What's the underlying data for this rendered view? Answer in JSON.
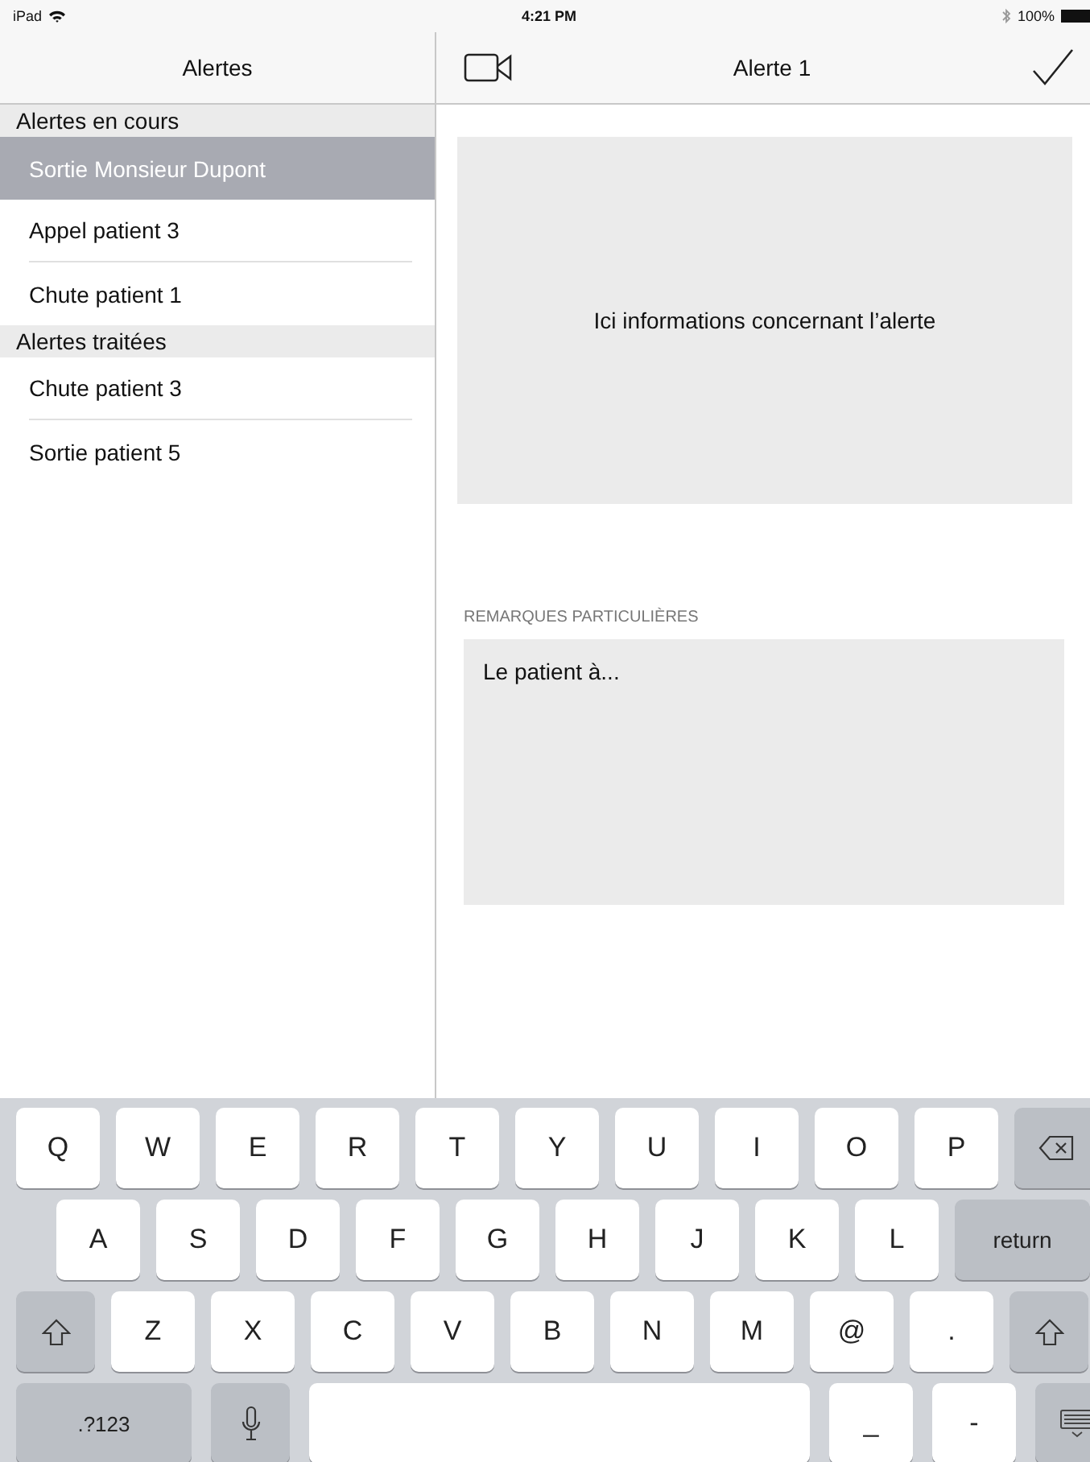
{
  "status_bar": {
    "carrier": "iPad",
    "time": "4:21 PM",
    "battery": "100%"
  },
  "master": {
    "title": "Alertes",
    "sections": [
      {
        "title": "Alertes en cours",
        "items": [
          {
            "label": "Sortie Monsieur Dupont",
            "selected": true
          },
          {
            "label": "Appel patient 3",
            "selected": false
          },
          {
            "label": "Chute patient 1",
            "selected": false
          }
        ]
      },
      {
        "title": "Alertes traitées",
        "items": [
          {
            "label": "Chute patient 3",
            "selected": false
          },
          {
            "label": "Sortie patient 5",
            "selected": false
          }
        ]
      }
    ]
  },
  "detail": {
    "title": "Alerte 1",
    "info": "Ici informations concernant l’alerte",
    "remarks_label": "REMARQUES PARTICULIÈRES",
    "remarks_value": "Le patient à..."
  },
  "keyboard": {
    "rows": [
      [
        {
          "kind": "char",
          "label": "Q"
        },
        {
          "kind": "char",
          "label": "W"
        },
        {
          "kind": "char",
          "label": "E"
        },
        {
          "kind": "char",
          "label": "R"
        },
        {
          "kind": "char",
          "label": "T"
        },
        {
          "kind": "char",
          "label": "Y"
        },
        {
          "kind": "char",
          "label": "U"
        },
        {
          "kind": "char",
          "label": "I"
        },
        {
          "kind": "char",
          "label": "O"
        },
        {
          "kind": "char",
          "label": "P"
        },
        {
          "kind": "backspace"
        }
      ],
      [
        {
          "kind": "char",
          "label": "A"
        },
        {
          "kind": "char",
          "label": "S"
        },
        {
          "kind": "char",
          "label": "D"
        },
        {
          "kind": "char",
          "label": "F"
        },
        {
          "kind": "char",
          "label": "G"
        },
        {
          "kind": "char",
          "label": "H"
        },
        {
          "kind": "char",
          "label": "J"
        },
        {
          "kind": "char",
          "label": "K"
        },
        {
          "kind": "char",
          "label": "L"
        },
        {
          "kind": "return",
          "label": "return"
        }
      ],
      [
        {
          "kind": "shift"
        },
        {
          "kind": "char",
          "label": "Z"
        },
        {
          "kind": "char",
          "label": "X"
        },
        {
          "kind": "char",
          "label": "C"
        },
        {
          "kind": "char",
          "label": "V"
        },
        {
          "kind": "char",
          "label": "B"
        },
        {
          "kind": "char",
          "label": "N"
        },
        {
          "kind": "char",
          "label": "M"
        },
        {
          "kind": "char",
          "label": "@"
        },
        {
          "kind": "char",
          "label": "."
        },
        {
          "kind": "shift"
        }
      ],
      [
        {
          "kind": "numbers",
          "label": ".?123"
        },
        {
          "kind": "mic"
        },
        {
          "kind": "space"
        },
        {
          "kind": "char",
          "label": "_"
        },
        {
          "kind": "char",
          "label": "-"
        },
        {
          "kind": "hide"
        }
      ]
    ]
  }
}
